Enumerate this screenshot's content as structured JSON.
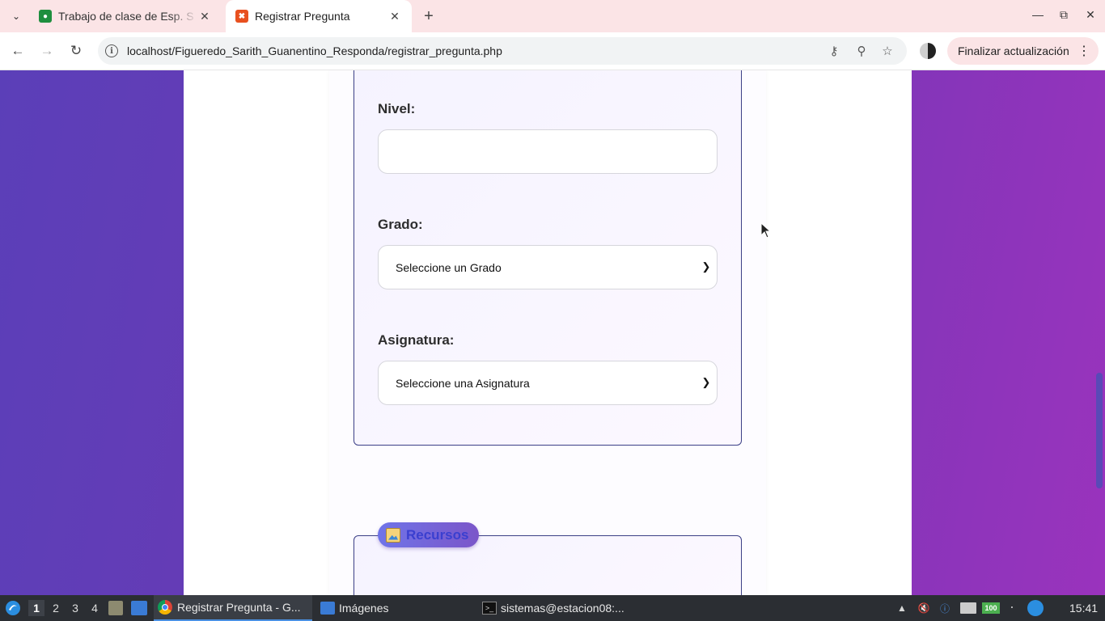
{
  "browser": {
    "tabs": [
      {
        "title": "Trabajo de clase de Esp. S",
        "active": false,
        "favicon": "google-classroom-icon",
        "favicon_color": "#1e8e3e"
      },
      {
        "title": "Registrar Pregunta",
        "active": true,
        "favicon": "xampp-icon",
        "favicon_color": "#e8501f"
      }
    ],
    "address_url": "localhost/Figueredo_Sarith_Guanentino_Responda/registrar_pregunta.php",
    "update_button_label": "Finalizar actualización"
  },
  "form": {
    "nivel_label": "Nivel:",
    "nivel_value": "",
    "grado_label": "Grado:",
    "grado_selected": "Seleccione un Grado",
    "asignatura_label": "Asignatura:",
    "asignatura_selected": "Seleccione una Asignatura",
    "recursos_legend": "Recursos"
  },
  "taskbar": {
    "workspaces": [
      "1",
      "2",
      "3",
      "4"
    ],
    "active_workspace": "1",
    "windows": [
      {
        "label": "Registrar Pregunta - G...",
        "icon": "chrome-icon",
        "active": true
      },
      {
        "label": "Imágenes",
        "icon": "folder-icon",
        "active": false
      },
      {
        "label": "sistemas@estacion08:...",
        "icon": "terminal-icon",
        "active": false
      }
    ],
    "battery_label": "100",
    "clock": "15:41"
  },
  "colors": {
    "tabbar_bg": "#fbe4e6",
    "page_gradient_start": "#5b3fb8",
    "page_gradient_end": "#9a33bd",
    "fieldset_border": "#3b3f86",
    "legend_text": "#3a3fd0"
  }
}
